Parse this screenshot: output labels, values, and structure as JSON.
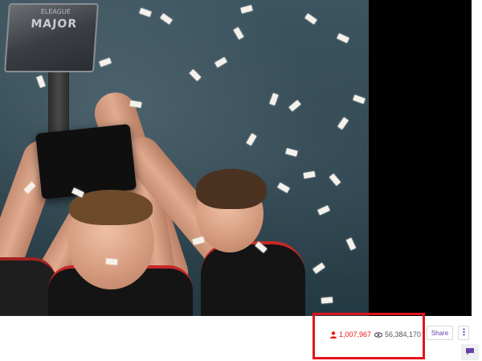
{
  "video": {
    "scene_logo_top": "ELEAGUE",
    "scene_logo_main": "MAJOR"
  },
  "stats": {
    "viewer_count": "1,007,967",
    "view_count": "56,384,170",
    "viewer_icon": "person-icon",
    "views_icon": "eye-icon",
    "viewer_color": "#e91916",
    "views_color": "#53535f"
  },
  "actions": {
    "share_label": "Share",
    "more_icon": "vertical-ellipsis-icon",
    "chat_icon": "chat-bubble-icon"
  },
  "annotation": {
    "highlight_color": "#e3141b"
  },
  "theme": {
    "accent": "#6441a4"
  }
}
